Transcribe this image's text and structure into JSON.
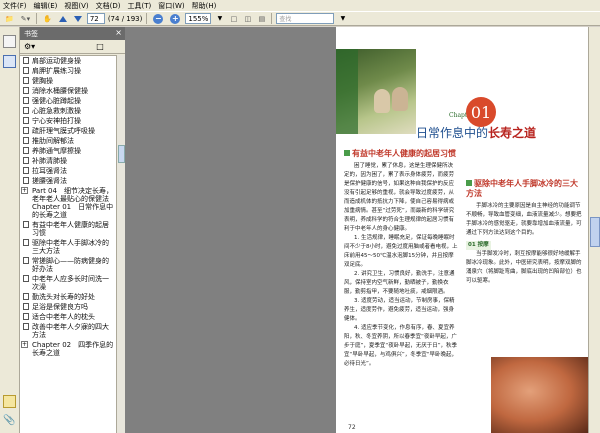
{
  "menu": [
    "文件(F)",
    "编辑(E)",
    "视图(V)",
    "文档(D)",
    "工具(T)",
    "窗口(W)",
    "帮助(H)"
  ],
  "toolbar": {
    "page_current": "72",
    "page_total": "(74 / 193)",
    "zoom": "155%",
    "search_placeholder": "查找"
  },
  "panel": {
    "title": "书签",
    "bookmarks": [
      {
        "label": "肩部运动健身操",
        "kind": "page"
      },
      {
        "label": "肩胛扩展练习操",
        "kind": "page"
      },
      {
        "label": "健胸操",
        "kind": "page"
      },
      {
        "label": "消除水桶腰保健操",
        "kind": "page"
      },
      {
        "label": "强健心脏蹲起操",
        "kind": "page"
      },
      {
        "label": "心脏急救刺激操",
        "kind": "page"
      },
      {
        "label": "宁心安神拍打操",
        "kind": "page"
      },
      {
        "label": "疏肝理气膜式呼吸操",
        "kind": "page"
      },
      {
        "label": "推肋间解郁法",
        "kind": "page"
      },
      {
        "label": "养肺通气摩擦操",
        "kind": "page"
      },
      {
        "label": "补肺清肺操",
        "kind": "page"
      },
      {
        "label": "拉耳强肾法",
        "kind": "page"
      },
      {
        "label": "搓腰强肾法",
        "kind": "page"
      },
      {
        "label": "Part 04　细节决定长寿，老年老人最贴心的保健法Chapter 01　日常作息中的长寿之道",
        "kind": "plus"
      },
      {
        "label": "有益中老年人健康的起居习惯",
        "kind": "page"
      },
      {
        "label": "驱除中老年人手脚冰冷的三大方法",
        "kind": "page"
      },
      {
        "label": "常搓脚心——防病健身的好办法",
        "kind": "page"
      },
      {
        "label": "中老年人应多长时间洗一次澡",
        "kind": "page"
      },
      {
        "label": "勤洗头对长寿的好处",
        "kind": "page"
      },
      {
        "label": "足浴是保健良方吗",
        "kind": "page"
      },
      {
        "label": "适合中老年人的枕头",
        "kind": "page"
      },
      {
        "label": "改善中老年人夕寐的四大方法",
        "kind": "page"
      },
      {
        "label": "Chapter 02　四季作息的长寿之道",
        "kind": "plus"
      }
    ]
  },
  "page": {
    "chapter_label": "Chapter",
    "chapter_num": "01",
    "title_plain": "日常作息中的",
    "title_bold": "长寿之道",
    "sec1_title": "有益中老年人健康的起居习惯",
    "sec1_body": "困了睡觉，累了休息，这是生理保健所决定的，因为困了，累了表示身体疲劳，而疲劳是保护健康的信号，如果这种自我保护的反应没有引起足够的重视，就会导致过度疲劳，从而造成机体的抵抗力下降，使自己容易得病或加重病情。甚至“过劳死”，而最新的科学研究表明，养成科学的符合生理规律的起居习惯有利于中老年人的身心健康。",
    "sec1_p1": "1. 生活规律，睡眠充足，保证每晚睡眠时间不少于8小时，避免过度用脑或者看电视，上床前用45～50℃温水泡脚15分钟，并且按摩双足底。",
    "sec1_p2": "2. 讲究卫生，习惯良好，勤洗手，注意通风，保持室内空气新鲜，勤晒被子，勤换衣服，勤剪指甲，不要随地吐痰，戒烟限酒。",
    "sec1_p3": "3. 适度劳动，适当运动，节制房事，保精养生，适度劳作，避免疲劳，适当运动，强身健体。",
    "sec1_p4": "4. 适应季节变化，作息有序，春、夏宜养阳，秋、冬宜养阴，所以春季宜“夜卧早起，广步于庭”，夏季宜“夜卧早起，无厌于日”，秋季宜“早卧早起，与鸡俱兴”，冬季宜“早卧晚起，必待日光”。",
    "sec2_title": "驱除中老年人手脚冰冷的三大方法",
    "sec2_body": "手脚冰冷的主要原因是自主神经的功能调节不顺畅，导致血管变细，血液流量减少。想要把手脚冰冷的感觉驱走，就要靠增加血液流量，可通过下列方法达到这个目的。",
    "sub1": "01 按摩",
    "sub1_body": "当手脚发冷时，刺互按摩能够很好地缓解手脚冰冷现象。此外，中医研究表明，按摩双脚的涌泉穴（将脚趾弯曲，脚底出现的凹陷部位）也可以驱寒。",
    "page_number": "72"
  }
}
